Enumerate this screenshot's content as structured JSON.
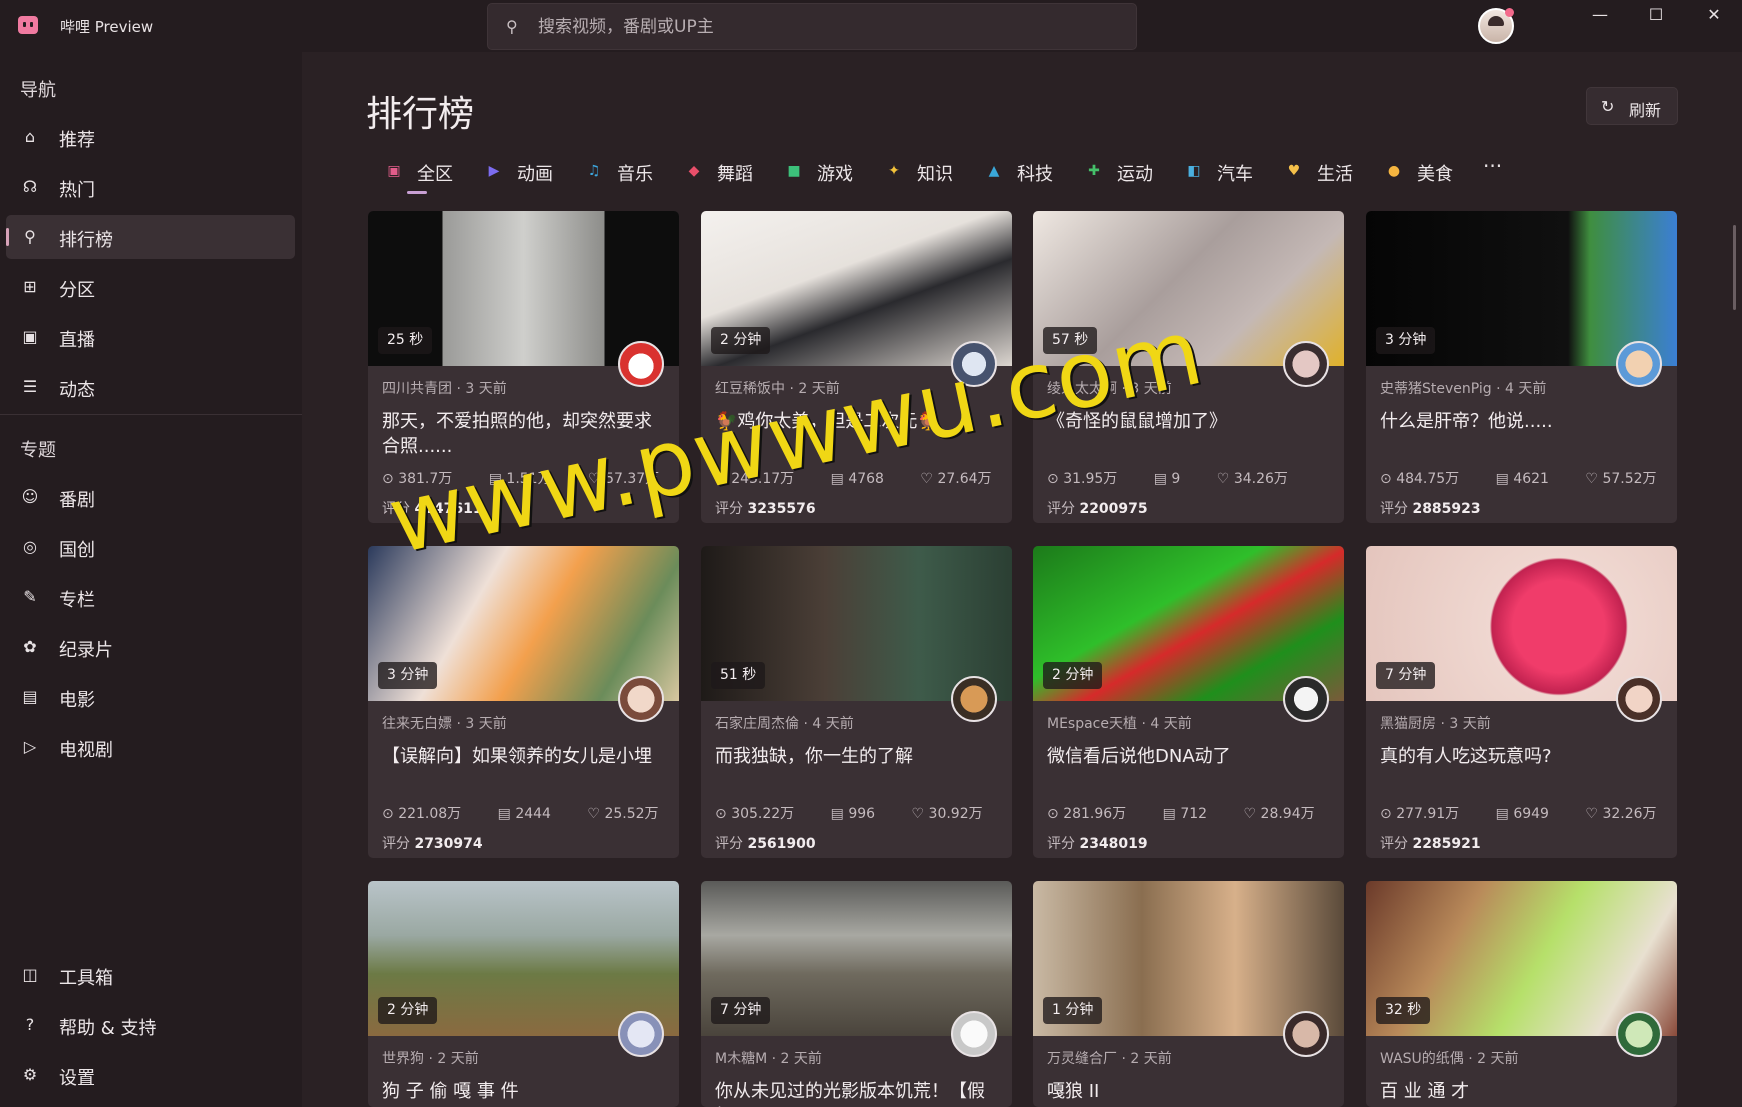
{
  "app": {
    "title": "哔哩 Preview"
  },
  "search": {
    "placeholder": "搜索视频，番剧或UP主"
  },
  "window": {
    "minimize": "—",
    "maximize": "☐",
    "close": "✕"
  },
  "sidebar": {
    "nav_title": "导航",
    "nav": [
      {
        "label": "推荐",
        "icon": "home-icon"
      },
      {
        "label": "热门",
        "icon": "fire-icon"
      },
      {
        "label": "排行榜",
        "icon": "trophy-icon",
        "active": true
      },
      {
        "label": "分区",
        "icon": "grid-icon"
      },
      {
        "label": "直播",
        "icon": "camera-icon"
      },
      {
        "label": "动态",
        "icon": "feed-icon"
      }
    ],
    "topics_title": "专题",
    "topics": [
      {
        "label": "番剧",
        "icon": "anime-icon"
      },
      {
        "label": "国创",
        "icon": "target-icon"
      },
      {
        "label": "专栏",
        "icon": "column-icon"
      },
      {
        "label": "纪录片",
        "icon": "documentary-icon"
      },
      {
        "label": "电影",
        "icon": "movie-icon"
      },
      {
        "label": "电视剧",
        "icon": "tv-icon"
      }
    ],
    "bottom": [
      {
        "label": "工具箱",
        "icon": "toolbox-icon"
      },
      {
        "label": "帮助 & 支持",
        "icon": "help-icon"
      },
      {
        "label": "设置",
        "icon": "settings-icon"
      }
    ]
  },
  "main": {
    "title": "排行榜",
    "refresh_label": "刷新",
    "tabs": [
      {
        "label": "全区",
        "color": "#e25c8a"
      },
      {
        "label": "动画",
        "color": "#7c6cf0"
      },
      {
        "label": "音乐",
        "color": "#3da8e0"
      },
      {
        "label": "舞蹈",
        "color": "#e94f6a"
      },
      {
        "label": "游戏",
        "color": "#3cc07a"
      },
      {
        "label": "知识",
        "color": "#f3c23a"
      },
      {
        "label": "科技",
        "color": "#3aa7d8"
      },
      {
        "label": "运动",
        "color": "#45c06a"
      },
      {
        "label": "汽车",
        "color": "#4ab0e0"
      },
      {
        "label": "生活",
        "color": "#f5c04a"
      },
      {
        "label": "美食",
        "color": "#f5b540"
      }
    ],
    "more": "···",
    "score_label": "评分",
    "cards": [
      {
        "duration": "25 秒",
        "meta": "四川共青团 · 3 天前",
        "title": "那天，不爱拍照的他，却突然要求合照......",
        "views": "381.7万",
        "danmaku": "1.51万",
        "likes": "57.37万",
        "score": "4147611",
        "thumb": "linear-gradient(90deg,#0d0d0d 0%,#0d0d0d 24%,#9a9a98 24%,#cfcfcc 50%,#8d8d8a 76%,#0d0d0d 76%)",
        "avatar": "radial-gradient(circle at 50% 55%,#fff 0 40%,#d9322f 41%)"
      },
      {
        "duration": "2 分钟",
        "meta": "红豆稀饭中 · 2 天前",
        "title": "🐓鸡你太美，但是二次元🐓",
        "views": "243.17万",
        "danmaku": "4768",
        "likes": "27.64万",
        "score": "3235576",
        "thumb": "linear-gradient(160deg,#f4f1ee 0%,#e6e1dc 40%,#2a2a2e 60%,#dcd6d0 100%)",
        "avatar": "radial-gradient(circle,#dfe6f2 0 40%,#47536e 41%)"
      },
      {
        "duration": "57 秒",
        "meta": "绫人太太啊 · 3 天前",
        "title": "《奇怪的鼠鼠增加了》",
        "views": "31.95万",
        "danmaku": "9",
        "likes": "34.26万",
        "score": "2200975",
        "thumb": "linear-gradient(135deg,#efe8e2 0%,#a99e9c 45%,#c4b8b5 70%,#e0b12a 100%)",
        "avatar": "radial-gradient(circle,#e4c8c4 0 45%,#3a2e30 46%)"
      },
      {
        "duration": "3 分钟",
        "meta": "史蒂猪StevenPig · 4 天前",
        "title": "什么是肝帝？他说.....",
        "views": "484.75万",
        "danmaku": "4621",
        "likes": "57.52万",
        "score": "2885923",
        "thumb": "linear-gradient(90deg,#050505 0%,#101010 65%,#3f8e3f 72%,#3b7fd4 100%)",
        "avatar": "radial-gradient(circle,#f2d1b1 0 45%,#5c9ad8 46%)"
      },
      {
        "duration": "3 分钟",
        "meta": "往来无白嫖 · 3 天前",
        "title": "【误解向】如果领养的女儿是小埋",
        "views": "221.08万",
        "danmaku": "2444",
        "likes": "25.52万",
        "score": "2730974",
        "thumb": "linear-gradient(120deg,#2b3a5c 0%,#efe0d7 35%,#f3a04d 55%,#6b8c5a 80%,#d8c7a0 100%)",
        "avatar": "radial-gradient(circle,#f1d8c9 0 45%,#7a4b3b 46%)"
      },
      {
        "duration": "51 秒",
        "meta": "石家庄周杰倫 · 4 天前",
        "title": "而我独缺，你一生的了解",
        "views": "305.22万",
        "danmaku": "996",
        "likes": "30.92万",
        "score": "2561900",
        "thumb": "linear-gradient(90deg,#1e1a18 0%,#4b3f37 40%,#3e5b4a 70%,#2b3f33 100%)",
        "avatar": "radial-gradient(circle,#d89a56 0 45%,#3a2e24 46%)"
      },
      {
        "duration": "2 分钟",
        "meta": "MEspace天植 · 4 天前",
        "title": "微信看后说他DNA动了",
        "views": "281.96万",
        "danmaku": "712",
        "likes": "28.94万",
        "score": "2348019",
        "thumb": "linear-gradient(150deg,#1c7a1a 0%,#2fbf2a 40%,#d62a2a 55%,#1f8f1c 75%,#7a5a3a 100%)",
        "avatar": "radial-gradient(circle,#f4f4f4 0 40%,#2a2a2a 41%)"
      },
      {
        "duration": "7 分钟",
        "meta": "黑猫厨房 · 3 天前",
        "title": "真的有人吃这玩意吗?",
        "views": "277.91万",
        "danmaku": "6949",
        "likes": "32.26万",
        "score": "2285921",
        "thumb": "radial-gradient(circle at 62% 52%,#f03c6a 0 22%,#c22250 32%,#efd7d0 33%,#e4c5bd 100%)",
        "avatar": "radial-gradient(circle,#f1d4c6 0 45%,#4a3028 46%)"
      },
      {
        "duration": "2 分钟",
        "meta": "世界狗 · 2 天前",
        "title": "狗 子 偷 嘎 事 件",
        "views": "",
        "danmaku": "",
        "likes": "",
        "score": "",
        "thumb": "linear-gradient(180deg,#b9c4c9 0%,#9aa8a2 35%,#6c7a45 60%,#8a6a40 100%)",
        "avatar": "radial-gradient(circle,#e4e7f4 0 45%,#8891b8 46%)"
      },
      {
        "duration": "7 分钟",
        "meta": "M木糖M · 2 天前",
        "title": "你从未见过的光影版本饥荒！【假如",
        "views": "",
        "danmaku": "",
        "likes": "",
        "score": "",
        "thumb": "linear-gradient(180deg,#5a5a58 0%,#a8a8a2 35%,#6f6a5e 60%,#4a443c 100%)",
        "avatar": "radial-gradient(circle,#fafafa 0 45%,#c8c8c8 46%)"
      },
      {
        "duration": "1 分钟",
        "meta": "万灵缝合厂 · 2 天前",
        "title": "嘎狼 II",
        "views": "",
        "danmaku": "",
        "likes": "",
        "score": "",
        "thumb": "linear-gradient(90deg,#c9b9a4 0%,#8a6e50 35%,#d7b08a 65%,#5a4a3a 100%)",
        "avatar": "radial-gradient(circle,#d8b8a8 0 45%,#3a2a2a 46%)"
      },
      {
        "duration": "32 秒",
        "meta": "WASU的纸偶 · 2 天前",
        "title": "百 业 通 才",
        "views": "",
        "danmaku": "",
        "likes": "",
        "score": "",
        "thumb": "linear-gradient(120deg,#6b3a2a 0%,#b98a5a 30%,#b6e06a 55%,#e8e0d0 80%,#8a4a3a 100%)",
        "avatar": "radial-gradient(circle,#cfe8b8 0 45%,#2f6a3a 46%)"
      }
    ]
  },
  "watermark": "www.pwwwu.com"
}
